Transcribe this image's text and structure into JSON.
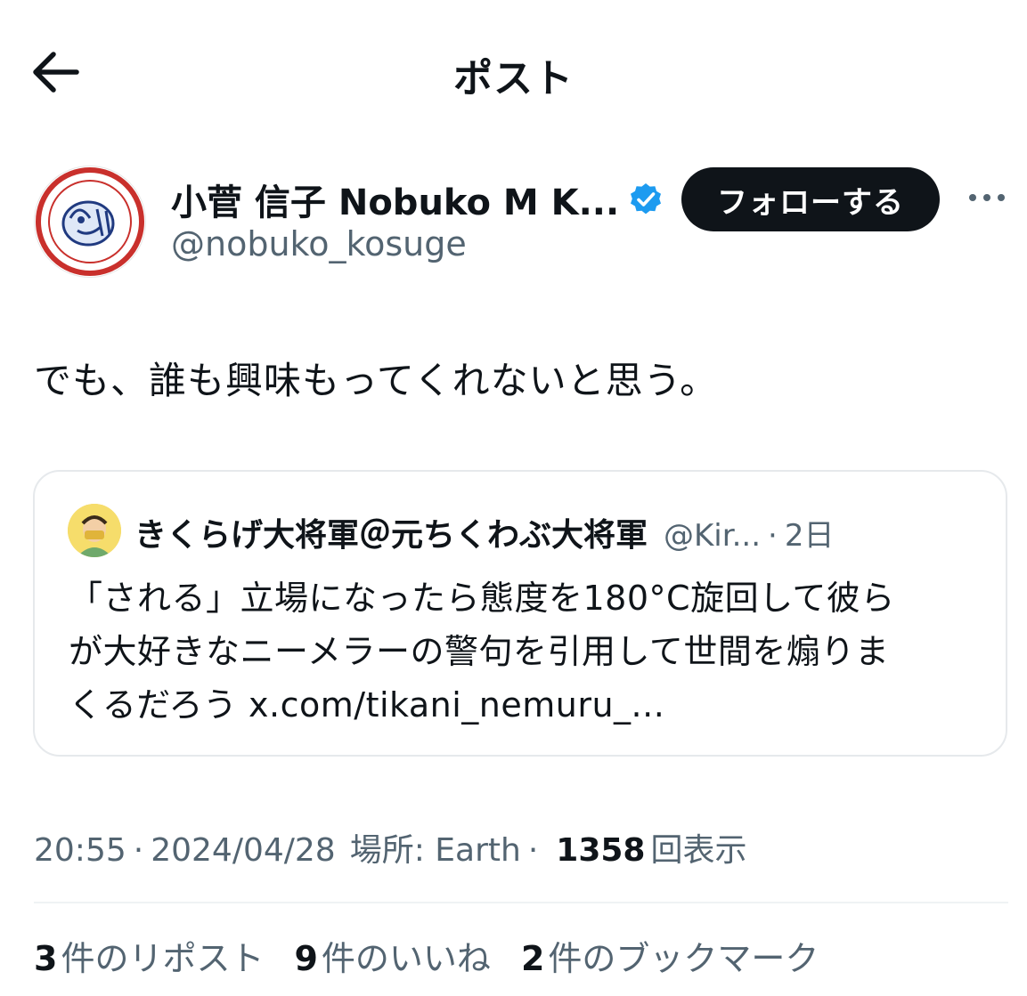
{
  "header": {
    "title": "ポスト",
    "back_icon": "back-arrow-icon"
  },
  "author": {
    "name": "小菅 信子 Nobuko M K...",
    "handle": "@nobuko_kosuge",
    "verified_icon": "verified-badge-icon",
    "verified_color": "#1d9bf0",
    "follow_label": "フォローする",
    "more_icon": "more-horizontal-icon"
  },
  "post": {
    "text": "でも、誰も興味もってくれないと思う。"
  },
  "quote": {
    "name": "きくらげ大将軍＠元ちくわぶ大将軍",
    "handle": "@Kir...",
    "dot": "·",
    "time": "2日",
    "lines": [
      "「される」立場になったら態度を180°C旋回して彼ら",
      "が大好きなニーメラーの警句を引用して世間を煽りま",
      "くるだろう x.com/tikani_nemuru_..."
    ]
  },
  "meta": {
    "time": "20:55",
    "sep": "·",
    "date": "2024/04/28",
    "location": "場所: Earth",
    "views_count": "1358",
    "views_label": "回表示"
  },
  "stats": [
    {
      "count": "3",
      "label": "件のリポスト"
    },
    {
      "count": "9",
      "label": "件のいいね"
    },
    {
      "count": "2",
      "label": "件のブックマーク"
    }
  ],
  "colors": {
    "text": "#0f1419",
    "muted": "#536471",
    "accent": "#1d9bf0",
    "border": "#e6e9ec"
  }
}
